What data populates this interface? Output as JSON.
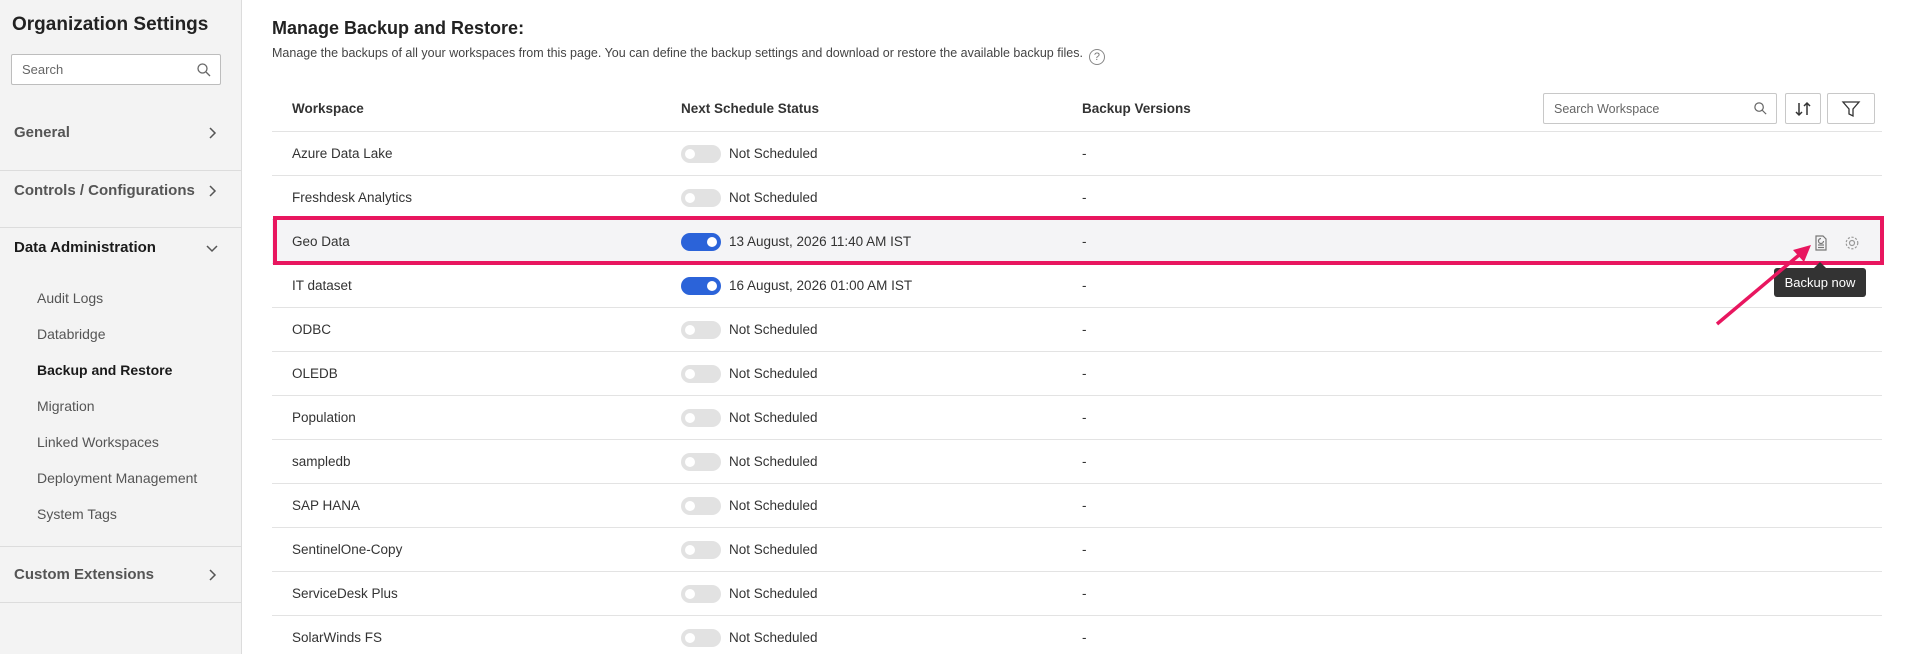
{
  "sidebar": {
    "title": "Organization Settings",
    "search_placeholder": "Search",
    "sections": [
      {
        "label": "General",
        "expanded": false
      },
      {
        "label": "Controls / Configurations",
        "expanded": false
      },
      {
        "label": "Data Administration",
        "expanded": true
      },
      {
        "label": "Custom Extensions",
        "expanded": false
      }
    ],
    "sub_items": [
      {
        "label": "Audit Logs"
      },
      {
        "label": "Databridge"
      },
      {
        "label": "Backup and Restore"
      },
      {
        "label": "Migration"
      },
      {
        "label": "Linked Workspaces"
      },
      {
        "label": "Deployment Management"
      },
      {
        "label": "System Tags"
      }
    ]
  },
  "main": {
    "title": "Manage Backup and Restore:",
    "description": "Manage the backups of all your workspaces from this page. You can define the backup settings and download or restore the available backup files.",
    "help_icon": "?",
    "columns": {
      "workspace": "Workspace",
      "next_schedule": "Next Schedule Status",
      "backup_versions": "Backup Versions"
    },
    "search_placeholder": "Search Workspace",
    "rows": [
      {
        "workspace": "Azure Data Lake",
        "enabled": false,
        "status": "Not Scheduled",
        "versions": "-"
      },
      {
        "workspace": "Freshdesk Analytics",
        "enabled": false,
        "status": "Not Scheduled",
        "versions": "-"
      },
      {
        "workspace": "Geo Data",
        "enabled": true,
        "status": "13 August, 2026 11:40 AM IST",
        "versions": "-"
      },
      {
        "workspace": "IT dataset",
        "enabled": true,
        "status": "16 August, 2026 01:00 AM IST",
        "versions": "-"
      },
      {
        "workspace": "ODBC",
        "enabled": false,
        "status": "Not Scheduled",
        "versions": "-"
      },
      {
        "workspace": "OLEDB",
        "enabled": false,
        "status": "Not Scheduled",
        "versions": "-"
      },
      {
        "workspace": "Population",
        "enabled": false,
        "status": "Not Scheduled",
        "versions": "-"
      },
      {
        "workspace": "sampledb",
        "enabled": false,
        "status": "Not Scheduled",
        "versions": "-"
      },
      {
        "workspace": "SAP HANA",
        "enabled": false,
        "status": "Not Scheduled",
        "versions": "-"
      },
      {
        "workspace": "SentinelOne-Copy",
        "enabled": false,
        "status": "Not Scheduled",
        "versions": "-"
      },
      {
        "workspace": "ServiceDesk Plus",
        "enabled": false,
        "status": "Not Scheduled",
        "versions": "-"
      },
      {
        "workspace": "SolarWinds FS",
        "enabled": false,
        "status": "Not Scheduled",
        "versions": "-"
      }
    ],
    "tooltip": "Backup now"
  },
  "colors": {
    "accent": "#2b63d9",
    "highlight": "#e8165f",
    "sidebar_bg": "#f3f3f3"
  }
}
